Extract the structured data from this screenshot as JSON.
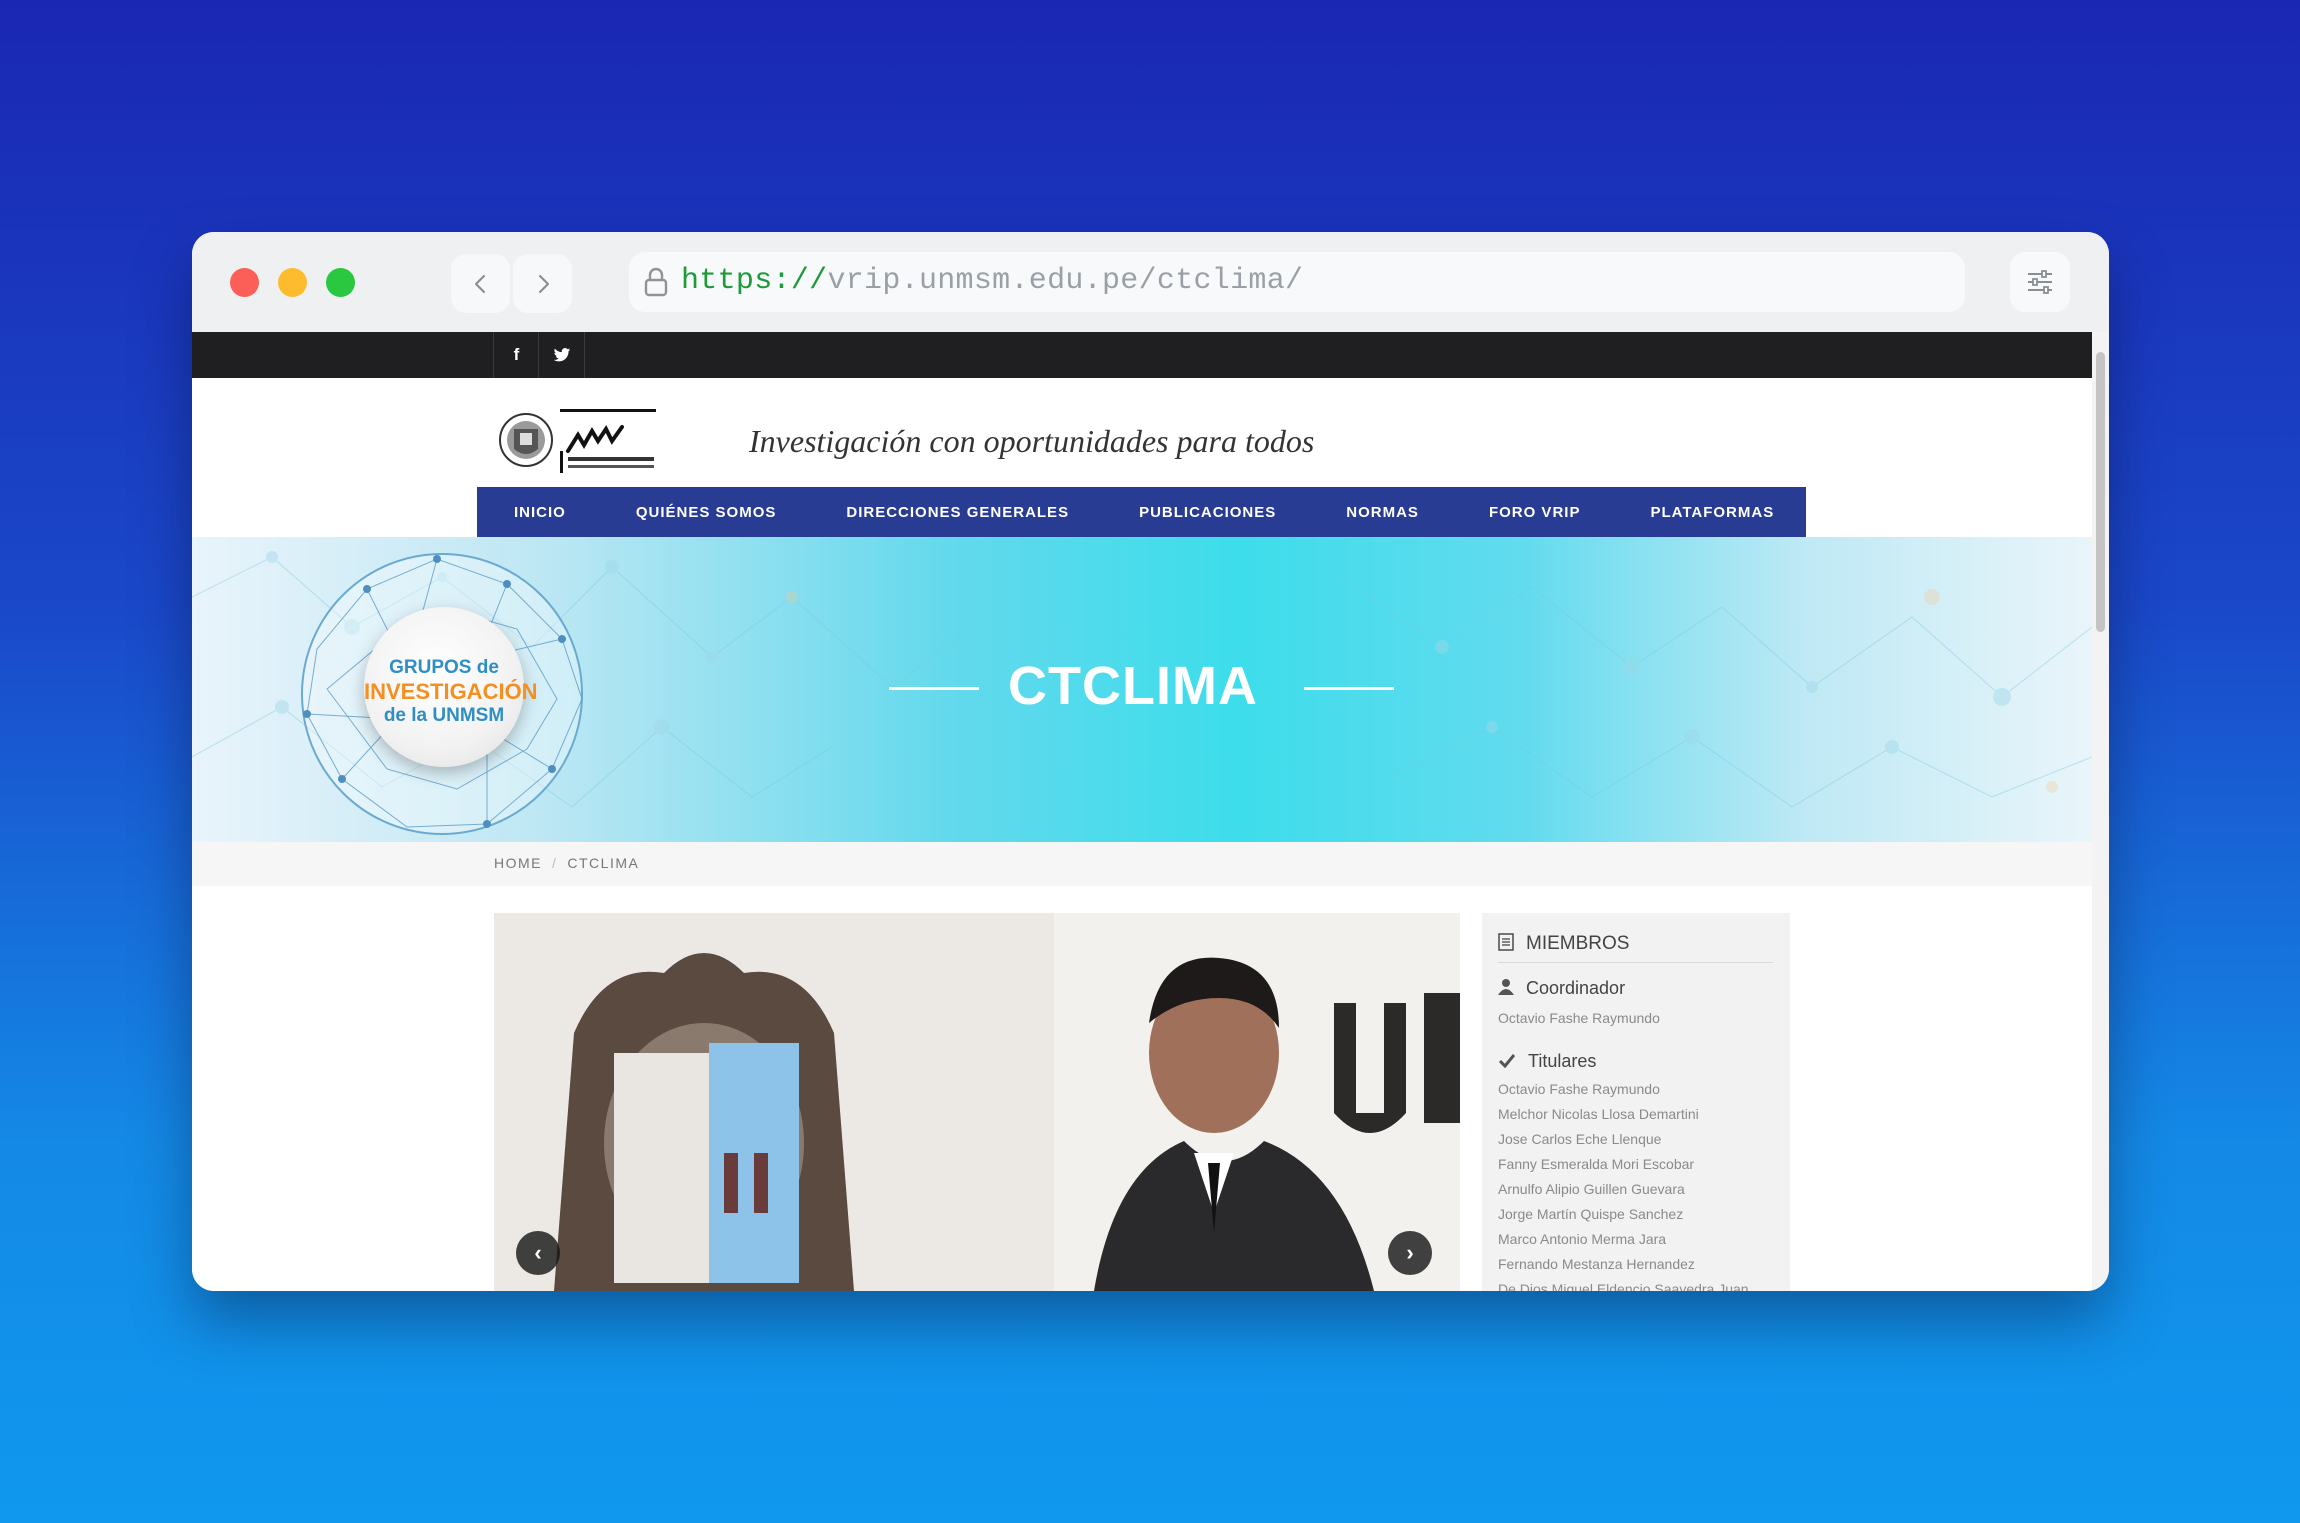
{
  "browser": {
    "url_scheme": "https://",
    "url_rest": "vrip.unmsm.edu.pe/ctclima/"
  },
  "site": {
    "tagline": "Investigación con oportunidades para todos",
    "nav": [
      "INICIO",
      "QUIÉNES SOMOS",
      "DIRECCIONES GENERALES",
      "PUBLICACIONES",
      "NORMAS",
      "FORO VRIP",
      "PLATAFORMAS"
    ],
    "hero_title": "CTCLIMA",
    "badge": {
      "line1": "GRUPOS de",
      "line2": "INVESTIGACIÓN",
      "line3": "de la UNMSM"
    },
    "breadcrumb": [
      "HOME",
      "CTCLIMA"
    ],
    "social": {
      "facebook": "f"
    }
  },
  "sidebar": {
    "title": "MIEMBROS",
    "coordinator_heading": "Coordinador",
    "coordinator": "Octavio Fashe Raymundo",
    "members_heading": "Titulares",
    "members": [
      "Octavio Fashe Raymundo",
      "Melchor Nicolas Llosa Demartini",
      "Jose Carlos Eche Llenque",
      "Fanny Esmeralda Mori Escobar",
      "Arnulfo Alipio Guillen Guevara",
      "Jorge Martín Quispe Sanchez",
      "Marco Antonio Merma Jara",
      "Fernando Mestanza Hernandez",
      "De Dios Miguel Eldencio Saavedra Juan"
    ]
  },
  "colors": {
    "nav_bg": "#283c93",
    "topbar_bg": "#1f1f22",
    "hero_cyan": "#3dddeb"
  }
}
